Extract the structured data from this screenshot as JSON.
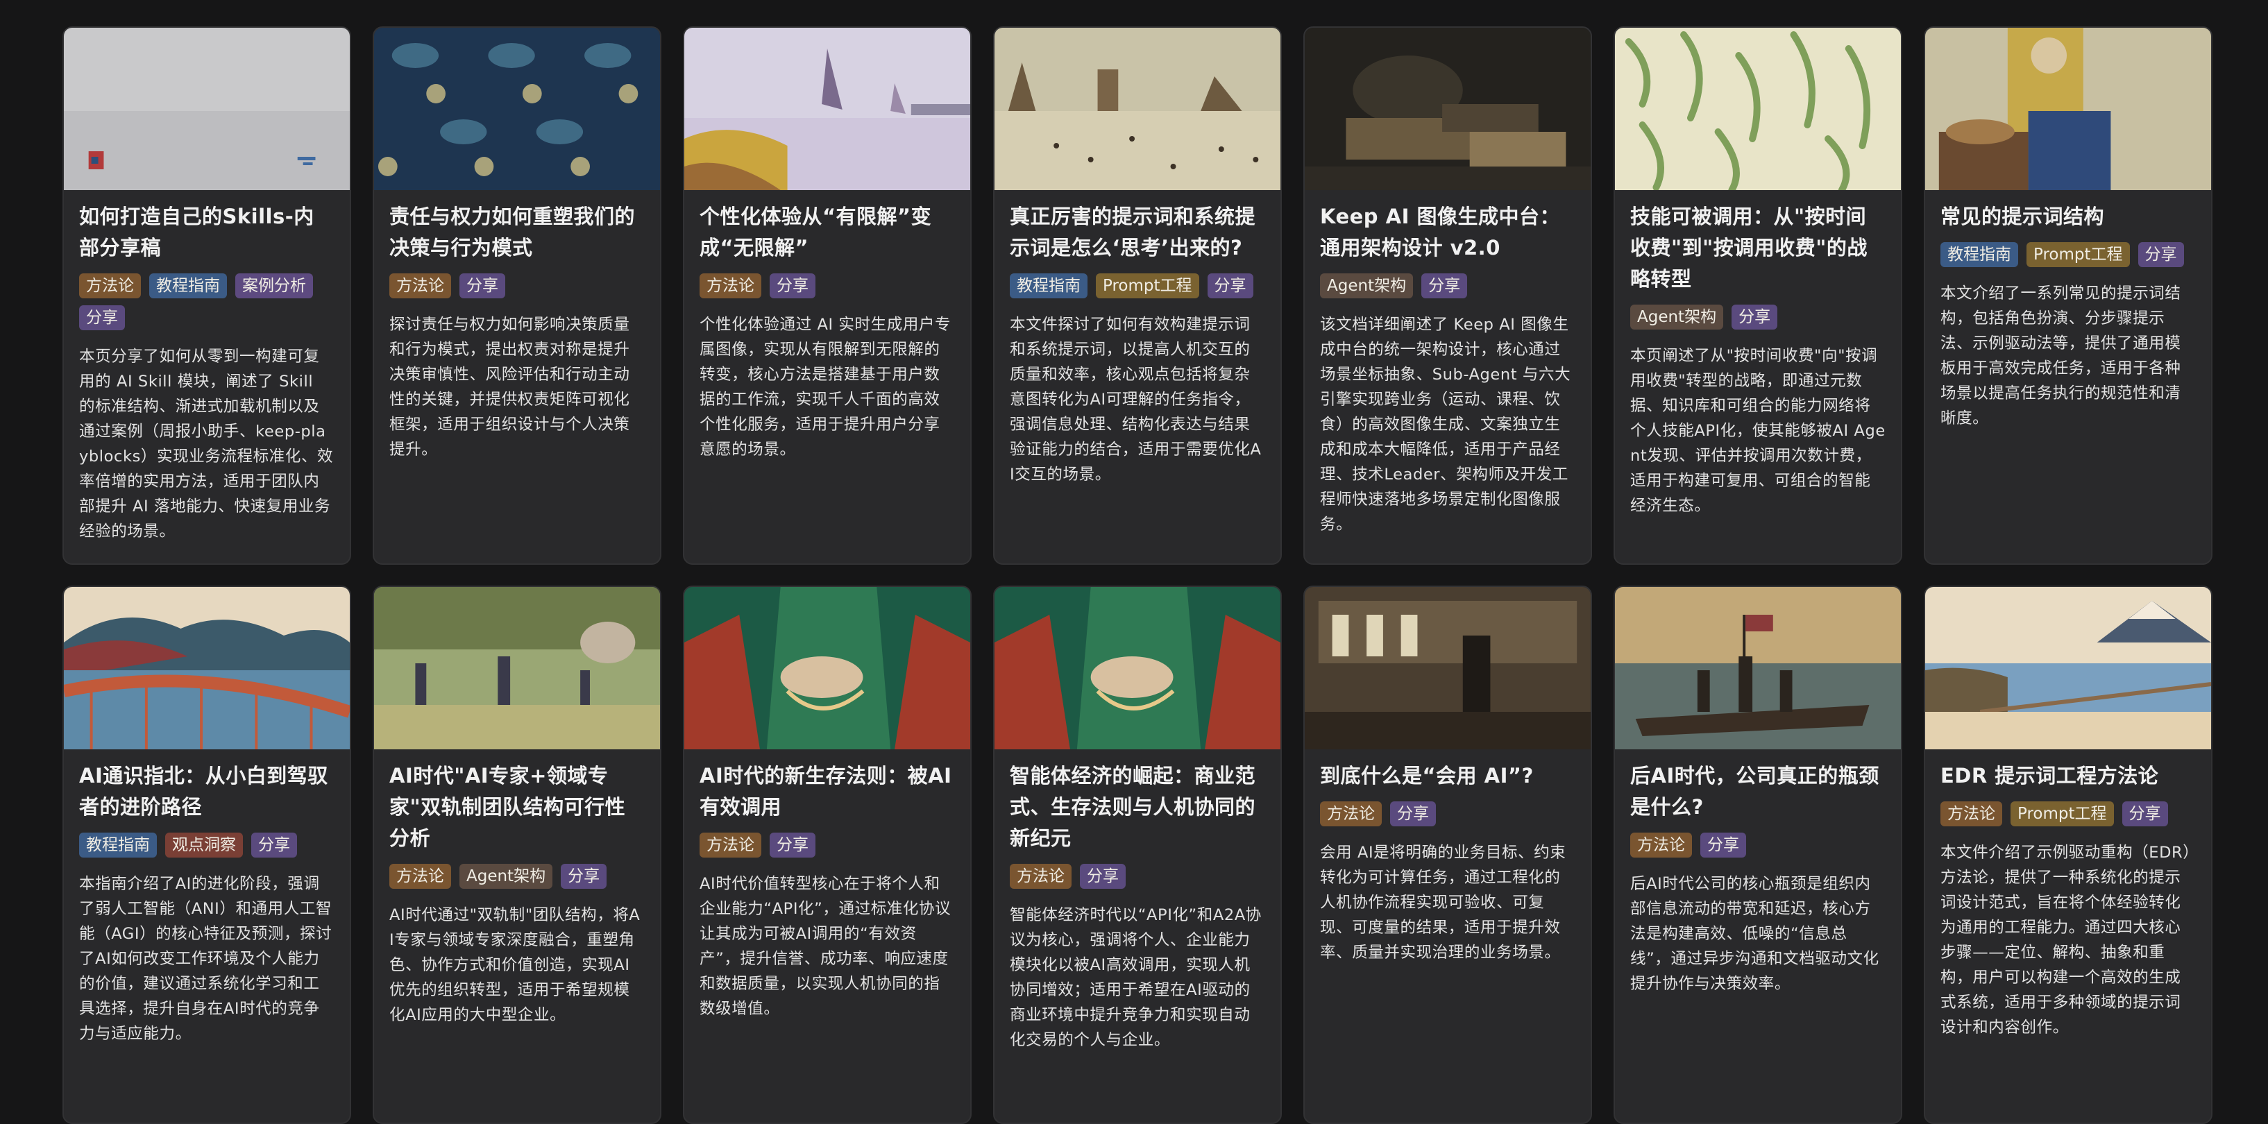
{
  "tag_colors": {
    "方法论": "#7a5530",
    "教程指南": "#3b5b86",
    "案例分析": "#5d4a80",
    "分享": "#5a4a7e",
    "Prompt工程": "#7a6230",
    "Agent架构": "#5a4a40",
    "观点洞察": "#7a3f35"
  },
  "cards": [
    {
      "thumb": "paper-abstract",
      "title": "如何打造自己的Skills-内部分享稿",
      "tags": [
        "方法论",
        "教程指南",
        "案例分析",
        "分享"
      ],
      "desc": "本页分享了如何从零到一构建可复用的 AI Skill 模块，阐述了 Skill 的标准结构、渐进式加载机制以及通过案例（周报小助手、keep-playblocks）实现业务流程标准化、效率倍增的实用方法，适用于团队内部提升 AI 落地能力、快速复用业务经验的场景。"
    },
    {
      "thumb": "bird-pattern",
      "title": "责任与权力如何重塑我们的决策与行为模式",
      "tags": [
        "方法论",
        "分享"
      ],
      "desc": "探讨责任与权力如何影响决策质量和行为模式，提出权责对称是提升决策审慎性、风险评估和行动主动性的关键，并提供权责矩阵可视化框架，适用于组织设计与个人决策提升。"
    },
    {
      "thumb": "harbor-pointillism",
      "title": "个性化体验从“有限解”变成“无限解”",
      "tags": [
        "方法论",
        "分享"
      ],
      "desc": "个性化体验通过 AI 实时生成用户专属图像，实现从有限解到无限解的转变，核心方法是搭建基于用户数据的工作流，实现千人千面的高效个性化服务，适用于提升用户分享意愿的场景。"
    },
    {
      "thumb": "winter-landscape",
      "title": "真正厉害的提示词和系统提示词是怎么‘思考’出来的?",
      "tags": [
        "教程指南",
        "Prompt工程",
        "分享"
      ],
      "desc": "本文件探讨了如何有效构建提示词和系统提示词，以提高人机交互的质量和效率，核心观点包括将复杂意图转化为AI可理解的任务指令，强调信息处理、结构化表达与结果验证能力的结合，适用于需要优化AI交互的场景。"
    },
    {
      "thumb": "still-life-dark",
      "title": "Keep AI 图像生成中台：通用架构设计 v2.0",
      "tags": [
        "Agent架构",
        "分享"
      ],
      "desc": "该文档详细阐述了 Keep AI 图像生成中台的统一架构设计，核心通过场景坐标抽象、Sub-Agent 与六大引擎实现跨业务（运动、课程、饮食）的高效图像生成、文案独立生成和成本大幅降低，适用于产品经理、技术Leader、架构师及开发工程师快速落地多场景定制化图像服务。"
    },
    {
      "thumb": "willow-pattern",
      "title": "技能可被调用：从\"按时间收费\"到\"按调用收费\"的战略转型",
      "tags": [
        "Agent架构",
        "分享"
      ],
      "desc": "本页阐述了从\"按时间收费\"向\"按调用收费\"转型的战略，即通过元数据、知识库和可组合的能力网络将个人技能API化，使其能够被AI Agent发现、评估并按调用次数计费，适用于构建可复用、可组合的智能经济生态。"
    },
    {
      "thumb": "milkmaid",
      "title": "常见的提示词结构",
      "tags": [
        "教程指南",
        "Prompt工程",
        "分享"
      ],
      "desc": "本文介绍了一系列常见的提示词结构，包括角色扮演、分步骤提示法、示例驱动法等，提供了通用模板用于高效完成任务，适用于各种场景以提高任务执行的规范性和清晰度。"
    },
    {
      "thumb": "ukiyoe-bridge",
      "title": "AI通识指北：从小白到驾驭者的进阶路径",
      "tags": [
        "教程指南",
        "观点洞察",
        "分享"
      ],
      "desc": "本指南介绍了AI的进化阶段，强调了弱人工智能（ANI）和通用人工智能（AGI）的核心特征及预测，探讨了AI如何改变工作环境及个人能力的价值，建议通过系统化学习和工具选择，提升自身在AI时代的竞争力与适应能力。"
    },
    {
      "thumb": "park-pointillism",
      "title": "AI时代\"AI专家+领域专家\"双轨制团队结构可行性分析",
      "tags": [
        "方法论",
        "Agent架构",
        "分享"
      ],
      "desc": "AI时代通过\"双轨制\"团队结构，将AI专家与领域专家深度融合，重塑角色、协作方式和价值创造，实现AI优先的组织转型，适用于希望规模化AI应用的大中型企业。"
    },
    {
      "thumb": "portrait-hands",
      "title": "AI时代的新生存法则：被AI有效调用",
      "tags": [
        "方法论",
        "分享"
      ],
      "desc": "AI时代价值转型核心在于将个人和企业能力“API化”，通过标准化协议让其成为可被AI调用的“有效资产”，提升信誉、成功率、响应速度和数据质量，以实现人机协同的指数级增值。"
    },
    {
      "thumb": "portrait-hands",
      "title": "智能体经济的崛起：商业范式、生存法则与人机协同的新纪元",
      "tags": [
        "方法论",
        "分享"
      ],
      "desc": "智能体经济时代以“API化”和A2A协议为核心，强调将个人、企业能力模块化以被AI高效调用，实现人机协同增效；适用于希望在AI驱动的商业环境中提升竞争力和实现自动化交易的个人与企业。"
    },
    {
      "thumb": "concert-hall",
      "title": "到底什么是“会用 AI”?",
      "tags": [
        "方法论",
        "分享"
      ],
      "desc": "会用 AI是将明确的业务目标、约束转化为可计算任务，通过工程化的人机协作流程实现可验收、可复现、可度量的结果，适用于提升效率、质量并实现治理的业务场景。"
    },
    {
      "thumb": "river-crossing",
      "title": "后AI时代，公司真正的瓶颈是什么?",
      "tags": [
        "方法论",
        "分享"
      ],
      "desc": "后AI时代公司的核心瓶颈是组织内部信息流动的带宽和延迟，核心方法是构建高效、低噪的“信息总线”，通过异步沟通和文档驱动文化提升协作与决策效率。"
    },
    {
      "thumb": "ukiyoe-bay",
      "title": "EDR 提示词工程方法论",
      "tags": [
        "方法论",
        "Prompt工程",
        "分享"
      ],
      "desc": "本文件介绍了示例驱动重构（EDR）方法论，提供了一种系统化的提示词设计范式，旨在将个体经验转化为通用的工程能力。通过四大核心步骤——定位、解构、抽象和重构，用户可以构建一个高效的生成式系统，适用于多种领域的提示词设计和内容创作。"
    }
  ]
}
